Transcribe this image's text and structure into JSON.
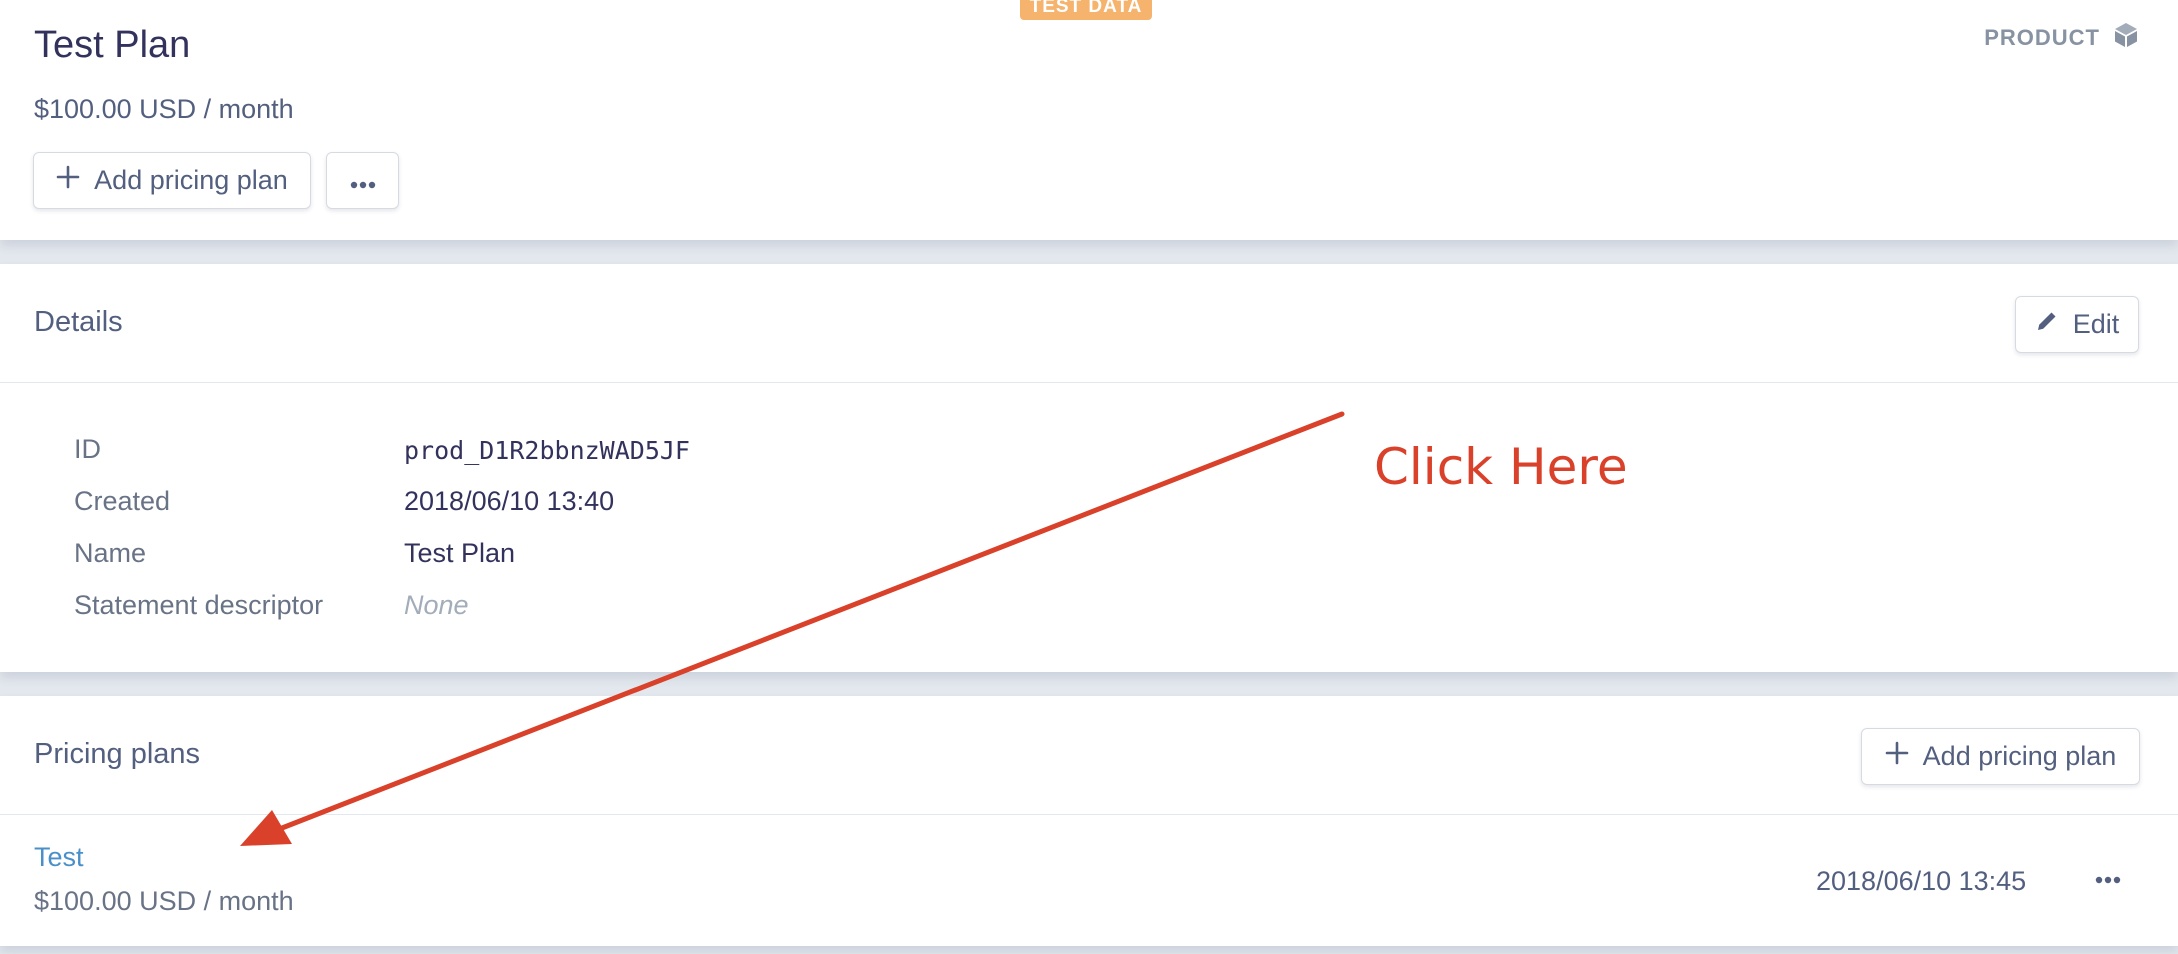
{
  "badge": {
    "text": "TEST DATA"
  },
  "header": {
    "product_label": "PRODUCT",
    "title": "Test Plan",
    "price": "$100.00 USD / month",
    "add_pricing_plan_label": "Add pricing plan"
  },
  "details": {
    "title": "Details",
    "edit_label": "Edit",
    "rows": [
      {
        "label": "ID",
        "value": "prod_D1R2bbnzWAD5JF"
      },
      {
        "label": "Created",
        "value": "2018/06/10 13:40"
      },
      {
        "label": "Name",
        "value": "Test Plan"
      },
      {
        "label": "Statement descriptor",
        "value": "None"
      }
    ]
  },
  "pricing_plans": {
    "title": "Pricing plans",
    "add_pricing_plan_label": "Add pricing plan",
    "items": [
      {
        "name": "Test",
        "price": "$100.00 USD / month",
        "created": "2018/06/10 13:45"
      }
    ]
  },
  "annotation": {
    "text": "Click Here",
    "color": "#d9412a"
  },
  "colors": {
    "link": "#4a90c8",
    "badge": "#f5b36d",
    "background": "#e3e8ee"
  }
}
